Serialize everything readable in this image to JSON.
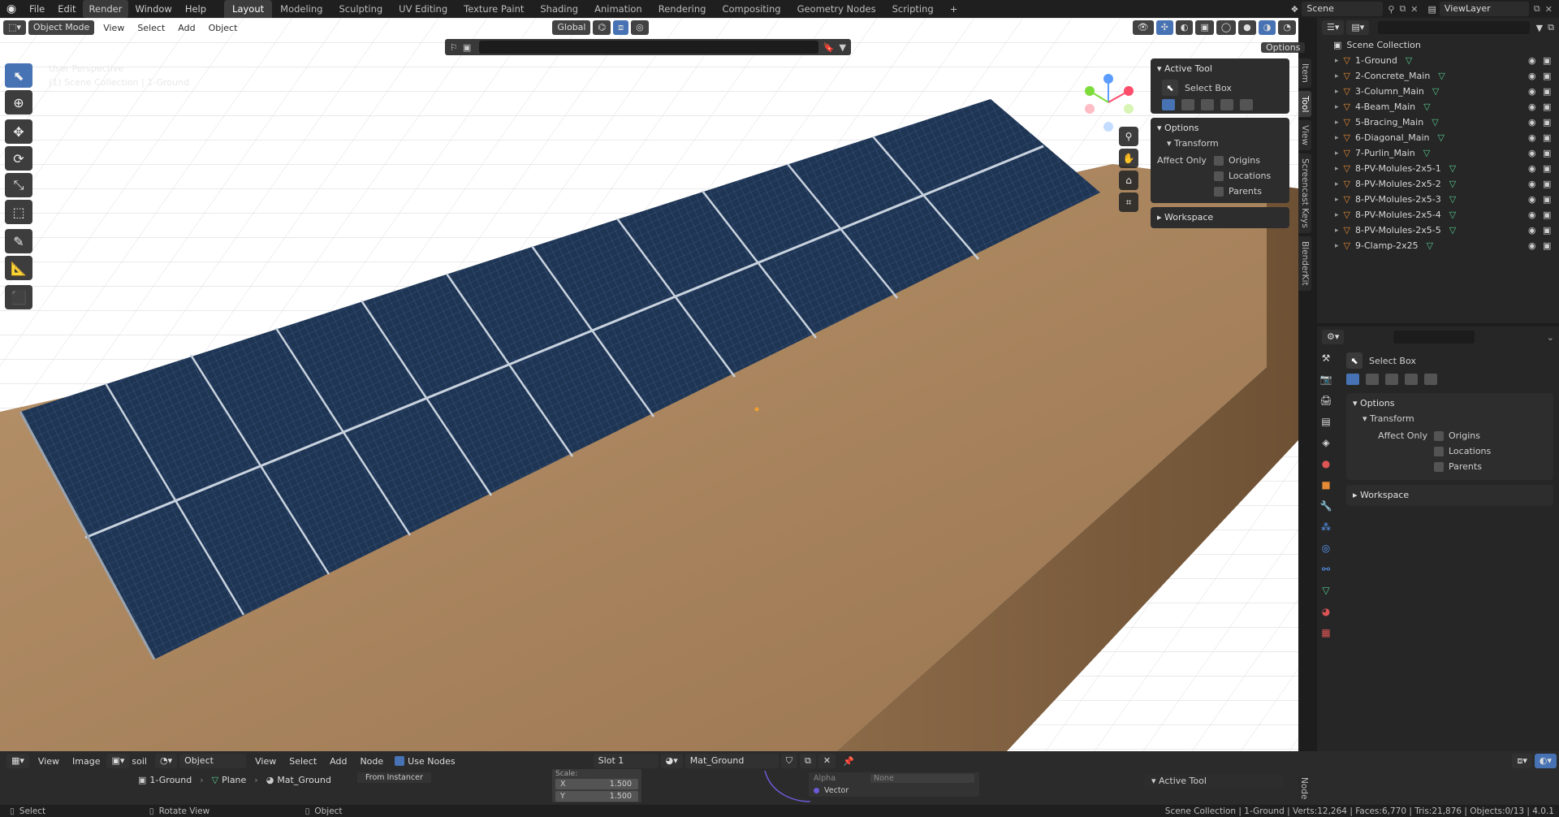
{
  "top_menu": [
    "File",
    "Edit",
    "Render",
    "Window",
    "Help"
  ],
  "workspace_tabs": [
    "Layout",
    "Modeling",
    "Sculpting",
    "UV Editing",
    "Texture Paint",
    "Shading",
    "Animation",
    "Rendering",
    "Compositing",
    "Geometry Nodes",
    "Scripting"
  ],
  "active_workspace": "Layout",
  "scene_name": "Scene",
  "view_layer": "ViewLayer",
  "viewport": {
    "mode": "Object Mode",
    "menus": [
      "View",
      "Select",
      "Add",
      "Object"
    ],
    "transform_orientation": "Global",
    "options_label": "Options",
    "overlay_text_1": "User Perspective",
    "overlay_text_2": "(1) Scene Collection | 1-Ground"
  },
  "npanel": {
    "active_tool_title": "Active Tool",
    "tool_name": "Select Box",
    "options_title": "Options",
    "transform_title": "Transform",
    "affect_only_label": "Affect Only",
    "origins": "Origins",
    "locations": "Locations",
    "parents": "Parents",
    "workspace_title": "Workspace",
    "tabs": [
      "Item",
      "Tool",
      "View",
      "Screencast Keys",
      "BlenderKit"
    ]
  },
  "outliner": {
    "root": "Scene Collection",
    "items": [
      "1-Ground",
      "2-Concrete_Main",
      "3-Column_Main",
      "4-Beam_Main",
      "5-Bracing_Main",
      "6-Diagonal_Main",
      "7-Purlin_Main",
      "8-PV-Molules-2x5-1",
      "8-PV-Molules-2x5-2",
      "8-PV-Molules-2x5-3",
      "8-PV-Molules-2x5-4",
      "8-PV-Molules-2x5-5",
      "9-Clamp-2x25"
    ]
  },
  "properties": {
    "tool_name": "Select Box",
    "options_title": "Options",
    "transform_title": "Transform",
    "affect_only_label": "Affect Only",
    "origins": "Origins",
    "locations": "Locations",
    "parents": "Parents",
    "workspace_title": "Workspace"
  },
  "bottom": {
    "image_menus": [
      "View",
      "Image"
    ],
    "image_field": "soil",
    "object_dropdown": "Object",
    "node_menus": [
      "View",
      "Select",
      "Add",
      "Node"
    ],
    "use_nodes": "Use Nodes",
    "from_instancer": "From Instancer",
    "slot": "Slot 1",
    "material": "Mat_Ground",
    "breadcrumb": [
      "1-Ground",
      "Plane",
      "Mat_Ground"
    ],
    "scale_label": "Scale:",
    "x_label": "X",
    "x_value": "1.500",
    "y_label": "Y",
    "y_value": "1.500",
    "alpha_label": "Alpha",
    "alpha_value": "None",
    "vector_label": "Vector",
    "active_tool": "Active Tool",
    "node_tab": "Node"
  },
  "status": {
    "left": "Select",
    "middle": "Rotate View",
    "right": "Object",
    "info": "Scene Collection | 1-Ground | Verts:12,264 | Faces:6,770 | Tris:21,876 | Objects:0/13 | 4.0.1"
  },
  "colors": {
    "accent": "#4772b3",
    "panel": "#2d2d2d",
    "object_icon": "#e58a36",
    "mesh_icon": "#56c98f",
    "soil": "#a7805a",
    "panel_blue": "#1f3554"
  }
}
